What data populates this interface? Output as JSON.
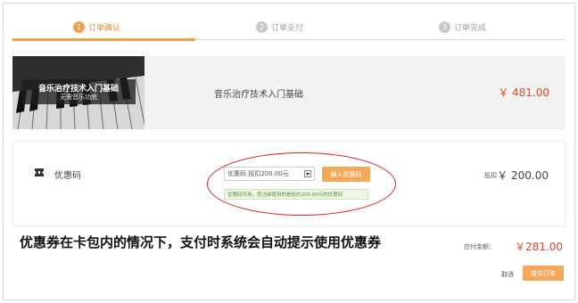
{
  "steps": [
    {
      "num": "1",
      "label": "订单确认",
      "active": true
    },
    {
      "num": "2",
      "label": "订单支付",
      "active": false
    },
    {
      "num": "3",
      "label": "订单完成",
      "active": false
    }
  ],
  "course": {
    "thumb_title": "音乐治疗技术入门基础",
    "thumb_subtitle": "无需音乐功底",
    "name": "音乐治疗技术入门基础",
    "price": "￥ 481.00"
  },
  "coupon": {
    "label": "优惠码",
    "select_value": "优惠码 抵扣200.00元",
    "input_button": "输入优惠码",
    "message": "优惠码可用，您当前使用的是抵价200.00元的优惠码",
    "deduct_label": "抵扣",
    "deduct_value": "￥ 200.00"
  },
  "caption": "优惠券在卡包内的情况下，支付时系统会自动提示使用优惠券",
  "totals": {
    "payable_label": "应付金额：",
    "payable_value": "￥281.00"
  },
  "actions": {
    "cancel": "取消",
    "submit": "提交订单"
  },
  "colors": {
    "accent": "#f3a85a",
    "price": "#e0472c",
    "annotation": "#e02020"
  }
}
